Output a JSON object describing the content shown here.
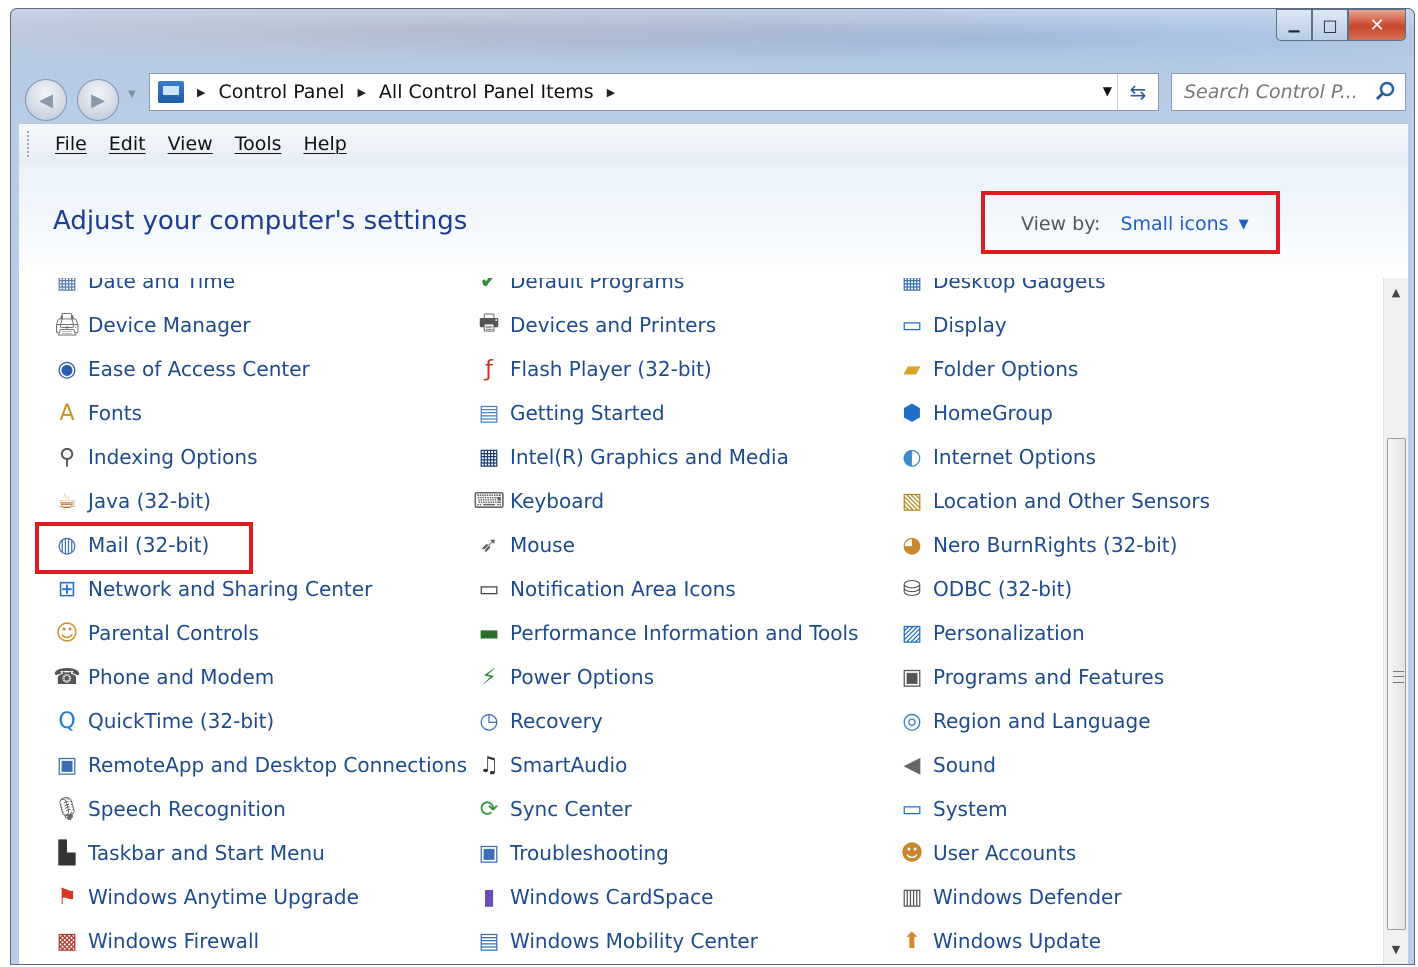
{
  "window": {
    "caption": {
      "minimize_glyph": "▁",
      "maximize_glyph": "□",
      "close_glyph": "✕"
    }
  },
  "address": {
    "crumbs": [
      "Control Panel",
      "All Control Panel Items"
    ],
    "search_placeholder": "Search Control P..."
  },
  "menu": [
    "File",
    "Edit",
    "View",
    "Tools",
    "Help"
  ],
  "header": {
    "title": "Adjust your computer's settings",
    "view_by_label": "View by:",
    "view_by_value": "Small icons"
  },
  "items": [
    [
      {
        "label": "Date and Time",
        "icon": "calendar-icon",
        "glyph": "▦",
        "color": "#5a7fb3"
      },
      {
        "label": "Device Manager",
        "icon": "device-manager-icon",
        "glyph": "🖨",
        "color": "#666"
      },
      {
        "label": "Ease of Access Center",
        "icon": "ease-of-access-icon",
        "glyph": "◉",
        "color": "#2a5cb3"
      },
      {
        "label": "Fonts",
        "icon": "fonts-icon",
        "glyph": "A",
        "color": "#c9951f"
      },
      {
        "label": "Indexing Options",
        "icon": "indexing-icon",
        "glyph": "⚲",
        "color": "#555"
      },
      {
        "label": "Java (32-bit)",
        "icon": "java-icon",
        "glyph": "☕",
        "color": "#b5651d"
      },
      {
        "label": "Mail (32-bit)",
        "icon": "mail-icon",
        "glyph": "◍",
        "color": "#3b6fb6"
      },
      {
        "label": "Network and Sharing Center",
        "icon": "network-icon",
        "glyph": "⊞",
        "color": "#2a6fc9"
      },
      {
        "label": "Parental Controls",
        "icon": "parental-controls-icon",
        "glyph": "☺",
        "color": "#d08a2b"
      },
      {
        "label": "Phone and Modem",
        "icon": "phone-modem-icon",
        "glyph": "☎",
        "color": "#555"
      },
      {
        "label": "QuickTime (32-bit)",
        "icon": "quicktime-icon",
        "glyph": "Q",
        "color": "#1f7fd6"
      },
      {
        "label": "RemoteApp and Desktop Connections",
        "icon": "remoteapp-icon",
        "glyph": "▣",
        "color": "#3a6fb6"
      },
      {
        "label": "Speech Recognition",
        "icon": "microphone-icon",
        "glyph": "🎙",
        "color": "#666"
      },
      {
        "label": "Taskbar and Start Menu",
        "icon": "taskbar-icon",
        "glyph": "▙",
        "color": "#333"
      },
      {
        "label": "Windows Anytime Upgrade",
        "icon": "windows-flag-icon",
        "glyph": "⚑",
        "color": "#d6352a"
      },
      {
        "label": "Windows Firewall",
        "icon": "firewall-icon",
        "glyph": "▩",
        "color": "#b03a2e"
      }
    ],
    [
      {
        "label": "Default Programs",
        "icon": "default-programs-icon",
        "glyph": "✔",
        "color": "#2e8b3a"
      },
      {
        "label": "Devices and Printers",
        "icon": "printer-icon",
        "glyph": "🖶",
        "color": "#555"
      },
      {
        "label": "Flash Player (32-bit)",
        "icon": "flash-icon",
        "glyph": "ƒ",
        "color": "#d42b1e"
      },
      {
        "label": "Getting Started",
        "icon": "getting-started-icon",
        "glyph": "▤",
        "color": "#4a83c8"
      },
      {
        "label": "Intel(R) Graphics and Media",
        "icon": "intel-graphics-icon",
        "glyph": "▦",
        "color": "#1c3d6b"
      },
      {
        "label": "Keyboard",
        "icon": "keyboard-icon",
        "glyph": "⌨",
        "color": "#666"
      },
      {
        "label": "Mouse",
        "icon": "mouse-icon",
        "glyph": "➶",
        "color": "#555"
      },
      {
        "label": "Notification Area Icons",
        "icon": "notification-icon",
        "glyph": "▭",
        "color": "#444"
      },
      {
        "label": "Performance Information and Tools",
        "icon": "performance-icon",
        "glyph": "▬",
        "color": "#2e6b2e"
      },
      {
        "label": "Power Options",
        "icon": "power-icon",
        "glyph": "⚡",
        "color": "#3a8a3a"
      },
      {
        "label": "Recovery",
        "icon": "recovery-icon",
        "glyph": "◷",
        "color": "#3a6fb6"
      },
      {
        "label": "SmartAudio",
        "icon": "audio-icon",
        "glyph": "♫",
        "color": "#333"
      },
      {
        "label": "Sync Center",
        "icon": "sync-icon",
        "glyph": "⟳",
        "color": "#2f9a3a"
      },
      {
        "label": "Troubleshooting",
        "icon": "troubleshooting-icon",
        "glyph": "▣",
        "color": "#3a6fb6"
      },
      {
        "label": "Windows CardSpace",
        "icon": "cardspace-icon",
        "glyph": "▮",
        "color": "#6b4fb3"
      },
      {
        "label": "Windows Mobility Center",
        "icon": "mobility-icon",
        "glyph": "▤",
        "color": "#3a6fb6"
      }
    ],
    [
      {
        "label": "Desktop Gadgets",
        "icon": "gadgets-icon",
        "glyph": "▦",
        "color": "#3a6fb6"
      },
      {
        "label": "Display",
        "icon": "display-icon",
        "glyph": "▭",
        "color": "#1f6fc9"
      },
      {
        "label": "Folder Options",
        "icon": "folder-icon",
        "glyph": "▰",
        "color": "#d9a528"
      },
      {
        "label": "HomeGroup",
        "icon": "homegroup-icon",
        "glyph": "⬢",
        "color": "#1f6fc9"
      },
      {
        "label": "Internet Options",
        "icon": "internet-options-icon",
        "glyph": "◐",
        "color": "#3a8ac9"
      },
      {
        "label": "Location and Other Sensors",
        "icon": "sensors-icon",
        "glyph": "▧",
        "color": "#b58a1f"
      },
      {
        "label": "Nero BurnRights (32-bit)",
        "icon": "nero-icon",
        "glyph": "◕",
        "color": "#c98a2b"
      },
      {
        "label": "ODBC (32-bit)",
        "icon": "odbc-icon",
        "glyph": "⛁",
        "color": "#555"
      },
      {
        "label": "Personalization",
        "icon": "personalization-icon",
        "glyph": "▨",
        "color": "#1f6fc9"
      },
      {
        "label": "Programs and Features",
        "icon": "programs-icon",
        "glyph": "▣",
        "color": "#555"
      },
      {
        "label": "Region and Language",
        "icon": "globe-icon",
        "glyph": "◎",
        "color": "#2a7fc9"
      },
      {
        "label": "Sound",
        "icon": "speaker-icon",
        "glyph": "◀",
        "color": "#666"
      },
      {
        "label": "System",
        "icon": "system-icon",
        "glyph": "▭",
        "color": "#1f6fc9"
      },
      {
        "label": "User Accounts",
        "icon": "user-accounts-icon",
        "glyph": "☻",
        "color": "#c9872b"
      },
      {
        "label": "Windows Defender",
        "icon": "defender-icon",
        "glyph": "▥",
        "color": "#555"
      },
      {
        "label": "Windows Update",
        "icon": "windows-update-icon",
        "glyph": "⬆",
        "color": "#d6862b"
      }
    ]
  ]
}
